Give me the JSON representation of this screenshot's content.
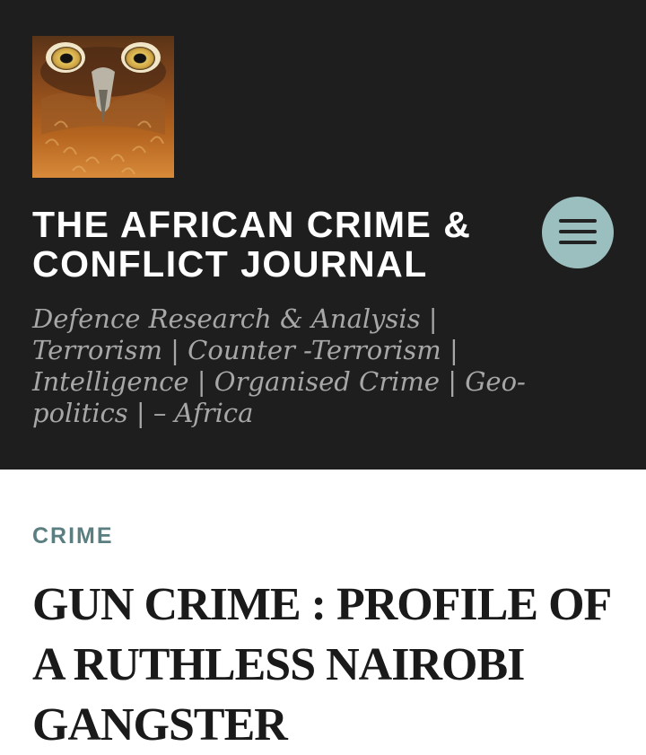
{
  "header": {
    "site_title": "THE AFRICAN CRIME & CONFLICT JOURNAL",
    "tagline": "Defence Research & Analysis | Terrorism | Counter -Terrorism | Intelligence | Organised Crime | Geo-politics | – Africa",
    "logo_icon": "owl-face-icon",
    "menu_icon": "hamburger-menu-icon",
    "menu_button_color": "#9bbfbe",
    "background_color": "#1f1e1e"
  },
  "post": {
    "category": "CRIME",
    "category_color": "#5b7f80",
    "title": "GUN CRIME : PROFILE OF A RUTHLESS NAIROBI GANGSTER"
  }
}
